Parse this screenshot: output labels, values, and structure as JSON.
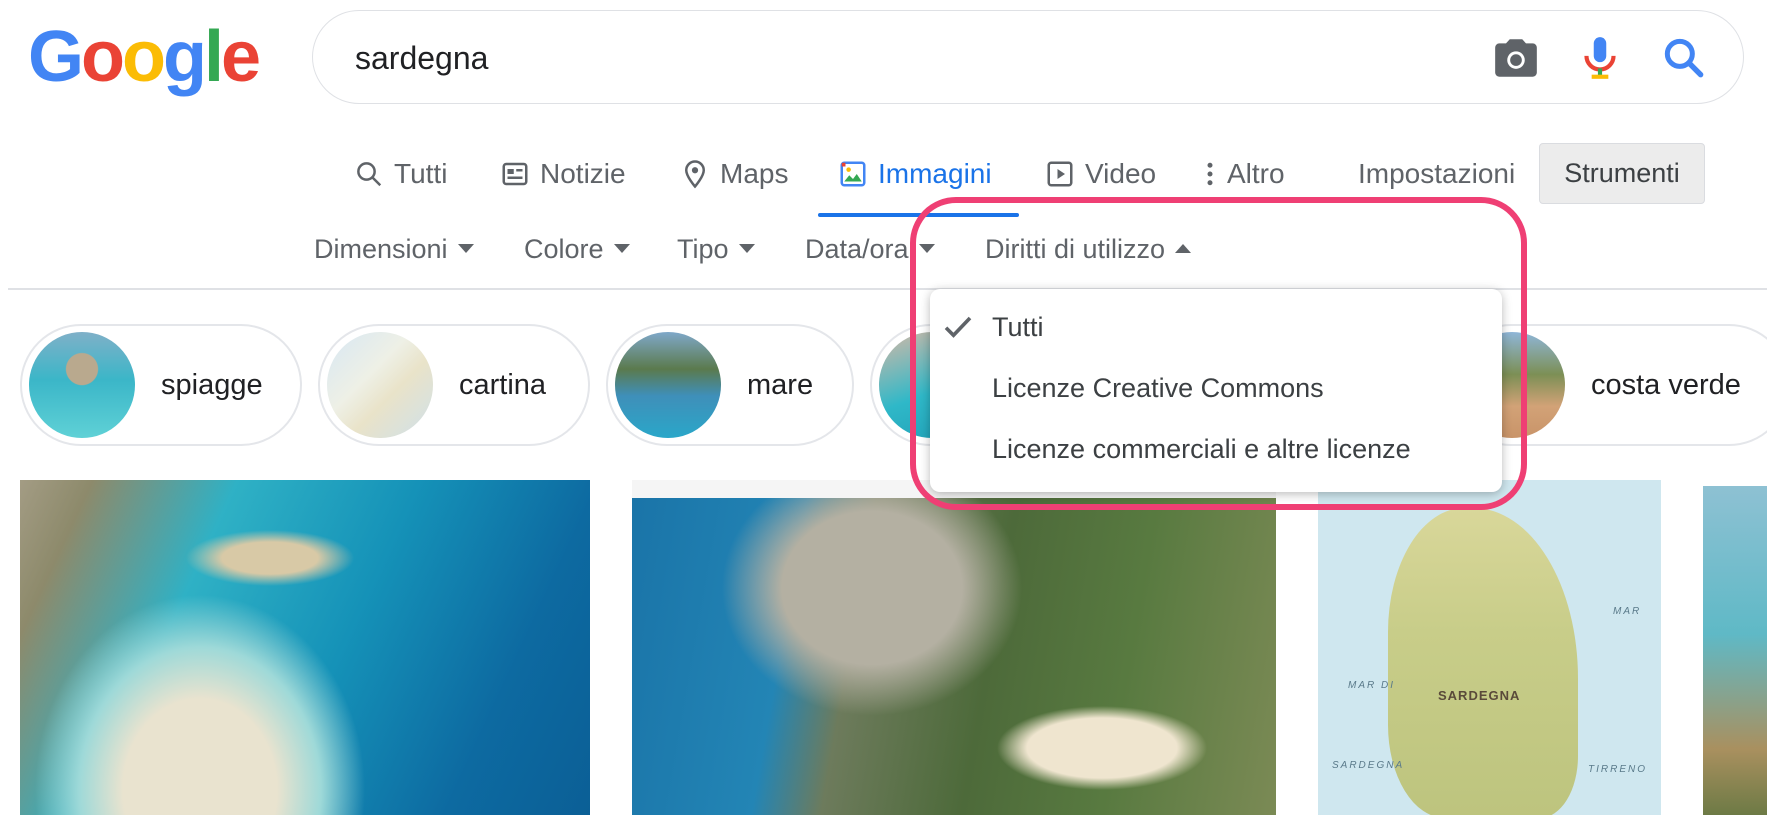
{
  "logo": {
    "text": "Google"
  },
  "search": {
    "query": "sardegna"
  },
  "tabs": [
    {
      "label": "Tutti",
      "icon": "search-icon"
    },
    {
      "label": "Notizie",
      "icon": "news-icon"
    },
    {
      "label": "Maps",
      "icon": "map-pin-icon"
    },
    {
      "label": "Immagini",
      "icon": "image-icon",
      "active": true
    },
    {
      "label": "Video",
      "icon": "play-icon"
    },
    {
      "label": "Altro",
      "icon": "more-vert-icon"
    }
  ],
  "settings_label": "Impostazioni",
  "tools_label": "Strumenti",
  "filters": [
    {
      "label": "Dimensioni"
    },
    {
      "label": "Colore"
    },
    {
      "label": "Tipo"
    },
    {
      "label": "Data/ora"
    },
    {
      "label": "Diritti di utilizzo"
    }
  ],
  "chips": [
    {
      "label": "spiagge"
    },
    {
      "label": "cartina"
    },
    {
      "label": "mare"
    },
    {
      "label": ""
    },
    {
      "label": "costa verde"
    }
  ],
  "usage_rights_menu": {
    "items": [
      {
        "label": "Tutti",
        "checked": true
      },
      {
        "label": "Licenze Creative Commons",
        "checked": false
      },
      {
        "label": "Licenze commerciali e altre licenze",
        "checked": false
      }
    ]
  },
  "map_image": {
    "labels": [
      "SARDEGNA",
      "MAR DI",
      "SARDEGNA",
      "MAR",
      "TIRRENO"
    ]
  },
  "colors": {
    "accent_blue": "#1a73e8",
    "highlight_pink": "#ef3f74",
    "text_gray": "#5f6368"
  }
}
